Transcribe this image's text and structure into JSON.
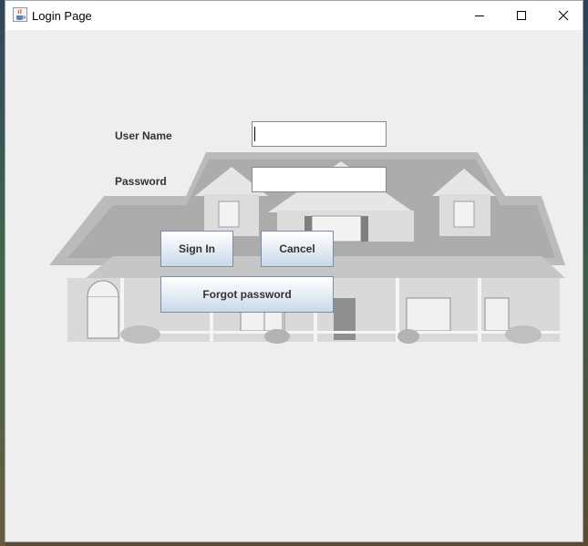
{
  "window": {
    "title": "Login Page"
  },
  "form": {
    "username_label": "User Name",
    "password_label": "Password",
    "username_value": "",
    "password_value": ""
  },
  "buttons": {
    "sign_in": "Sign In",
    "cancel": "Cancel",
    "forgot_password": "Forgot password"
  },
  "colors": {
    "window_bg": "#eeeeee",
    "button_gradient_top": "#ffffff",
    "button_gradient_bottom": "#c9d8e8",
    "label_text": "#333333"
  },
  "icons": {
    "app": "java-cup-icon",
    "minimize": "minimize-icon",
    "maximize": "maximize-icon",
    "close": "close-icon"
  }
}
